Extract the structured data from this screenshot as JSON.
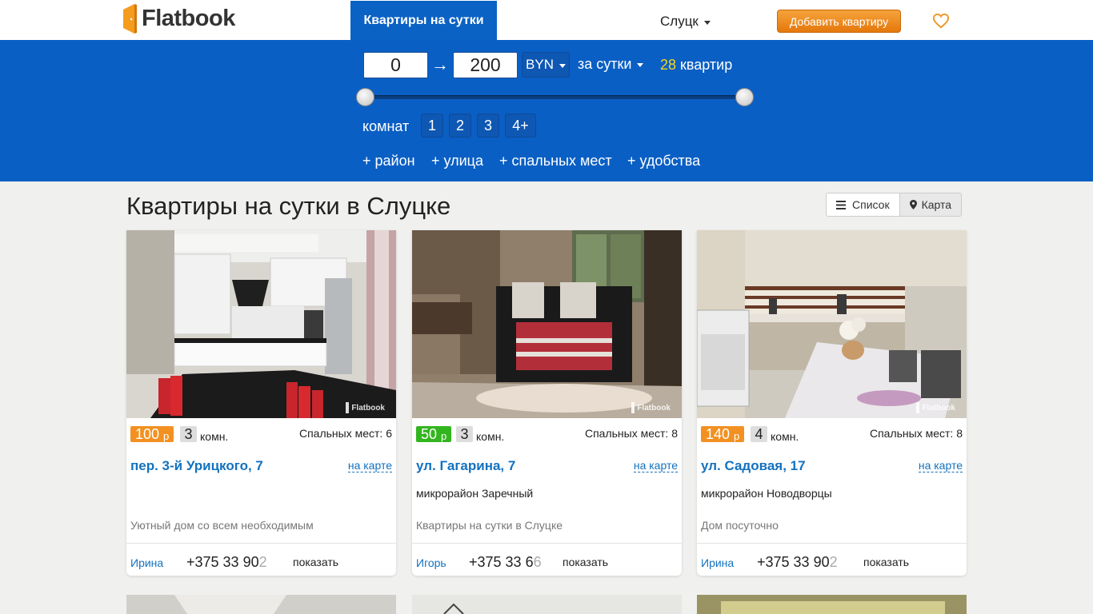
{
  "header": {
    "logo_text": "Flatbook",
    "nav_tab": "Квартиры на сутки",
    "city": "Слуцк",
    "add_button": "Добавить квартиру",
    "favorites_icon": "heart-icon",
    "brand_color": "#0a5fc4",
    "accent_color": "#ef8a1a"
  },
  "filter": {
    "price_min": "0",
    "arrow": "→",
    "price_max": "200",
    "currency": "BYN",
    "period": "за сутки",
    "count": "28",
    "count_label": "квартир",
    "rooms_label": "комнат",
    "rooms": [
      "1",
      "2",
      "3",
      "4+"
    ],
    "extras": [
      "+ район",
      "+ улица",
      "+ спальных мест",
      "+ удобства"
    ]
  },
  "main": {
    "title": "Квартиры на сутки в Слуцке",
    "view_list": "Список",
    "view_map": "Карта"
  },
  "listings": [
    {
      "price": "100",
      "price_currency": "р",
      "price_color": "#f29122",
      "rooms": "3",
      "rooms_unit": "комн.",
      "sleeps": "Спальных мест: 6",
      "address": "пер. 3-й Урицкого, 7",
      "on_map": "на карте",
      "district": "",
      "description": "Уютный дом со всем необходимым",
      "owner": "Ирина",
      "phone_visible": "+375 33 90",
      "phone_fade": "2",
      "show": "показать"
    },
    {
      "price": "50",
      "price_currency": "р",
      "price_color": "#33b51f",
      "rooms": "3",
      "rooms_unit": "комн.",
      "sleeps": "Спальных мест: 8",
      "address": "ул. Гагарина, 7",
      "on_map": "на карте",
      "district": "микрорайон Заречный",
      "description": "Квартиры на сутки в Слуцке",
      "owner": "Игорь",
      "phone_visible": "+375 33 6",
      "phone_fade": "6",
      "show": "показать"
    },
    {
      "price": "140",
      "price_currency": "р",
      "price_color": "#f29122",
      "rooms": "4",
      "rooms_unit": "комн.",
      "sleeps": "Спальных мест: 8",
      "address": "ул. Садовая, 17",
      "on_map": "на карте",
      "district": "микрорайон Новодворцы",
      "description": "Дом посуточно",
      "owner": "Ирина",
      "phone_visible": "+375 33 90",
      "phone_fade": "2",
      "show": "показать"
    }
  ],
  "watermark": "Flatbook"
}
